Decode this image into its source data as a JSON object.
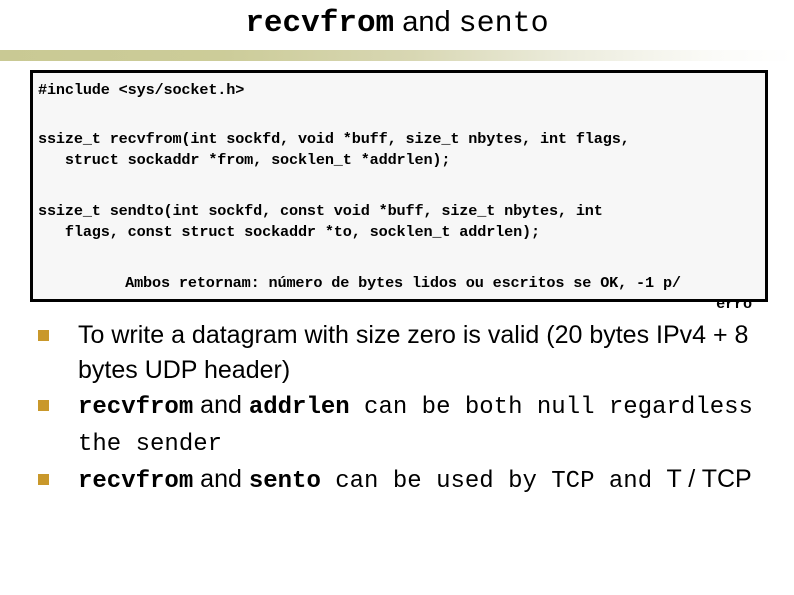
{
  "slide": {
    "title": {
      "part_mono_bold": "recvfrom",
      "part_sans": " and ",
      "part_mono": " sento"
    },
    "divider_color_left": "#CCCC99",
    "divider_color_right": "#FFFFFF"
  },
  "code_block": {
    "background": "#F7F7F7",
    "border_color": "#000000",
    "include_line": "#include <sys/socket.h>",
    "recvfrom_signature_line1": "ssize_t recvfrom(int sockfd, void *buff, size_t nbytes, int flags,",
    "recvfrom_signature_line2": "   struct sockaddr *from, socklen_t *addrlen);",
    "sendto_signature_line1": "ssize_t sendto(int sockfd, const void *buff, size_t nbytes, int",
    "sendto_signature_line2": "   flags, const struct sockaddr *to, socklen_t addrlen);",
    "returns_line": "Ambos retornam: número de bytes lidos ou escritos se OK, -1 p/",
    "returns_line_overflow": "erro"
  },
  "bullets": {
    "marker_color": "#C9982B",
    "items": [
      {
        "segments": [
          {
            "text": "To write a datagram with size zero is valid (20 bytes IPv4 + 8 bytes UDP header)",
            "style": "sans"
          }
        ]
      },
      {
        "segments": [
          {
            "text": "recvfrom",
            "style": "mono-bold"
          },
          {
            "text": " and ",
            "style": "sans"
          },
          {
            "text": "addrlen",
            "style": "mono-bold"
          },
          {
            "text": " can be both null regardless the sender",
            "style": "mono"
          }
        ]
      },
      {
        "segments": [
          {
            "text": "recvfrom",
            "style": "mono-bold"
          },
          {
            "text": " and ",
            "style": "sans"
          },
          {
            "text": "sento",
            "style": "mono-bold"
          },
          {
            "text": " can be used by TCP and ",
            "style": "mono"
          },
          {
            "text": "T / TCP",
            "style": "sans"
          }
        ]
      }
    ]
  }
}
